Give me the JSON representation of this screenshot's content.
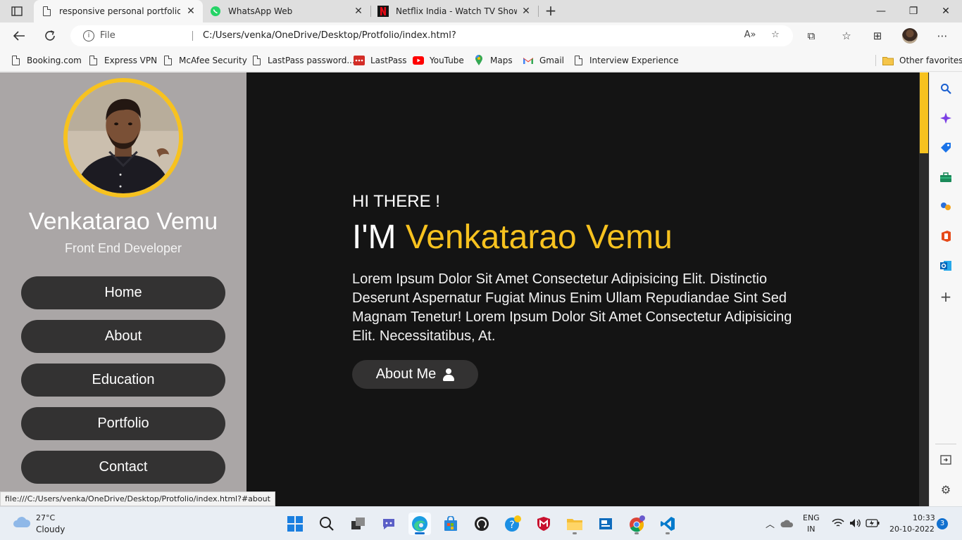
{
  "browser": {
    "tabs": [
      {
        "title": "responsive personal portfolio we",
        "icon": "document-icon",
        "active": true
      },
      {
        "title": "WhatsApp Web",
        "icon": "whatsapp-icon",
        "active": false
      },
      {
        "title": "Netflix India - Watch TV Shows C",
        "icon": "netflix-icon",
        "active": false
      }
    ],
    "address": {
      "scheme_label": "File",
      "url": "C:/Users/venka/OneDrive/Desktop/Protfolio/index.html?"
    },
    "favorites": [
      {
        "label": "Booking.com",
        "icon": "document-icon"
      },
      {
        "label": "Express VPN",
        "icon": "document-icon"
      },
      {
        "label": "McAfee Security",
        "icon": "document-icon"
      },
      {
        "label": "LastPass password...",
        "icon": "document-icon"
      },
      {
        "label": "LastPass",
        "icon": "lastpass-icon"
      },
      {
        "label": "YouTube",
        "icon": "youtube-icon"
      },
      {
        "label": "Maps",
        "icon": "maps-icon"
      },
      {
        "label": "Gmail",
        "icon": "gmail-icon"
      },
      {
        "label": "Interview Experience",
        "icon": "document-icon"
      }
    ],
    "other_favorites": "Other favorites",
    "status_url": "file:///C:/Users/venka/OneDrive/Desktop/Protfolio/index.html?#about"
  },
  "portfolio": {
    "name": "Venkatarao Vemu",
    "role": "Front End Developer",
    "nav": [
      "Home",
      "About",
      "Education",
      "Portfolio",
      "Contact"
    ],
    "greeting": "HI THERE !",
    "im_prefix": "I'M",
    "im_name": "Venkatarao Vemu",
    "description": "Lorem Ipsum Dolor Sit Amet Consectetur Adipisicing Elit. Distinctio Deserunt Aspernatur Fugiat Minus Enim Ullam Repudiandae Sint Sed Magnam Tenetur! Lorem Ipsum Dolor Sit Amet Consectetur Adipisicing Elit. Necessitatibus, At.",
    "about_button": "About Me",
    "accent_color": "#f7c21f"
  },
  "taskbar": {
    "weather": {
      "temp": "27°C",
      "desc": "Cloudy"
    },
    "language": {
      "line1": "ENG",
      "line2": "IN"
    },
    "time": "10:33",
    "date": "20-10-2022",
    "notifications": "3"
  }
}
